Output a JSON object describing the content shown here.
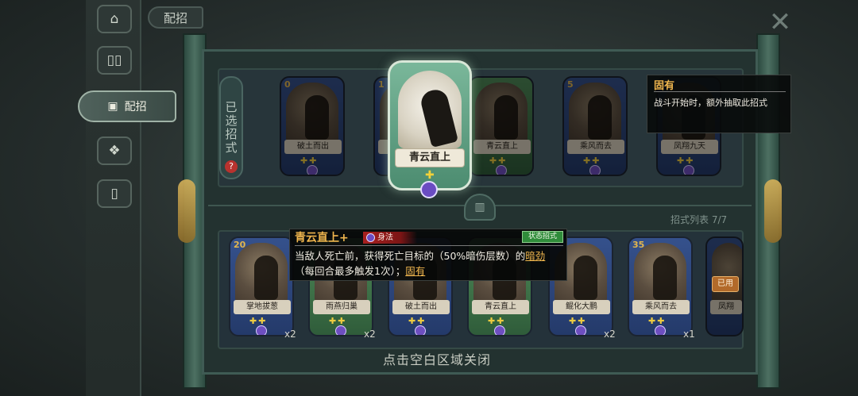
{
  "header": {
    "title": "配招"
  },
  "nav": {
    "items": [
      {
        "icon": "home-icon",
        "glyph": "⌂"
      },
      {
        "icon": "cards-icon",
        "glyph": "▯▯"
      },
      {
        "icon": "loadout-icon",
        "glyph": "▣",
        "label": "配招",
        "active": true
      },
      {
        "icon": "emblem-icon",
        "glyph": "❖"
      },
      {
        "icon": "card-single-icon",
        "glyph": "▯"
      }
    ]
  },
  "selected_section": {
    "label": "已选招式",
    "help": "?"
  },
  "selected_cards": [
    {
      "name": "破土而出",
      "cost": "0"
    },
    {
      "name": "",
      "cost": "1"
    },
    {
      "name": "青云直上",
      "cost": "",
      "green": true
    },
    {
      "name": "乘风而去",
      "cost": "5"
    },
    {
      "name": "凤翔九天",
      "cost": ""
    }
  ],
  "featured_card": {
    "name": "青云直上",
    "plus": "✚"
  },
  "keyword_tip": {
    "title": "固有",
    "body": "战斗开始时，额外抽取此招式"
  },
  "card_list": {
    "label": "招式列表",
    "count": "7/7"
  },
  "list_cards": [
    {
      "name": "掌地拔葱",
      "cost": "20",
      "count": "x2"
    },
    {
      "name": "雨燕归巢",
      "cost": "",
      "count": "x2",
      "green": true
    },
    {
      "name": "破土而出",
      "cost": "",
      "count": ""
    },
    {
      "name": "青云直上",
      "cost": "",
      "count": "",
      "green": true
    },
    {
      "name": "鲲化大鹏",
      "cost": "",
      "count": "x2"
    },
    {
      "name": "乘风而去",
      "cost": "35",
      "count": "x1"
    },
    {
      "name": "凤翔",
      "cost": "",
      "count": ""
    }
  ],
  "used_badge": "已用",
  "detail": {
    "title": "青云直上+",
    "type": "身法",
    "status": "状态招式",
    "body_pre": "当敌人死亡前，获得死亡目标的（50%暗伤层数）的",
    "keyword1": "暗劲",
    "body_mid": "（每回合最多触发1次）；",
    "keyword2": "固有"
  },
  "close_hint": "点击空白区域关闭",
  "close_glyph": "✕"
}
